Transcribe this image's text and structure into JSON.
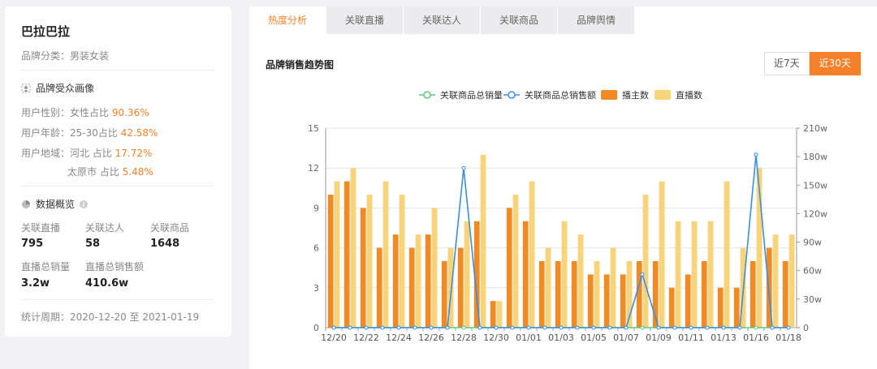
{
  "brand": {
    "name": "巴拉巴拉",
    "category": "品牌分类：男装女装"
  },
  "audience": {
    "title": "品牌受众画像",
    "gender_label": "用户性别：",
    "gender_text": "女性占比 ",
    "gender_value": "90.36%",
    "age_label": "用户年龄：",
    "age_text": "25-30占比 ",
    "age_value": "42.58%",
    "region_label": "用户地域：",
    "region1_text": "河北 占比 ",
    "region1_value": "17.72%",
    "region2_text": "太原市 占比 ",
    "region2_value": "5.48%"
  },
  "overview": {
    "title": "数据概览",
    "stats": [
      {
        "label": "关联直播",
        "value": "795"
      },
      {
        "label": "关联达人",
        "value": "58"
      },
      {
        "label": "关联商品",
        "value": "1648"
      },
      {
        "label": "直播总销量",
        "value": "3.2w"
      },
      {
        "label": "直播总销售额",
        "value": "410.6w"
      }
    ],
    "period": "统计周期：2020-12-20 至 2021-01-19"
  },
  "tabs": [
    "热度分析",
    "关联直播",
    "关联达人",
    "关联商品",
    "品牌舆情"
  ],
  "chart_title": "品牌销售趋势图",
  "range_buttons": [
    "近7天",
    "近30天"
  ],
  "colors": {
    "accent": "#f5822a",
    "bar1": "#f08a24",
    "bar2": "#f7d37a",
    "line_sales_qty": "#5ec77b",
    "line_sales_amt": "#3a8ee6"
  },
  "chart_data": {
    "type": "bar",
    "categories": [
      "12/20",
      "12/21",
      "12/22",
      "12/23",
      "12/24",
      "12/25",
      "12/26",
      "12/27",
      "12/28",
      "12/29",
      "12/30",
      "12/31",
      "01/01",
      "01/02",
      "01/03",
      "01/04",
      "01/05",
      "01/06",
      "01/07",
      "01/08",
      "01/09",
      "01/10",
      "01/11",
      "01/12",
      "01/13",
      "01/14",
      "01/16",
      "01/17",
      "01/18"
    ],
    "x_tick_labels": [
      "12/20",
      "12/22",
      "12/24",
      "12/26",
      "12/28",
      "12/30",
      "01/01",
      "01/03",
      "01/05",
      "01/07",
      "01/09",
      "01/11",
      "01/13",
      "01/16",
      "01/18"
    ],
    "series": [
      {
        "name": "关联商品总销量",
        "type": "line",
        "axis": "left",
        "values": [
          0,
          0,
          0,
          0,
          0,
          0,
          0,
          0,
          0,
          0,
          0,
          0,
          0,
          0,
          0,
          0,
          0,
          0,
          0,
          0,
          0,
          0,
          0,
          0,
          0,
          0,
          0,
          0,
          0
        ]
      },
      {
        "name": "关联商品总销售额",
        "type": "line",
        "axis": "right",
        "values": [
          0,
          0,
          0,
          0,
          0,
          0,
          0,
          0,
          168,
          0,
          0,
          0,
          0,
          0,
          0,
          0,
          0,
          0,
          0,
          56,
          0,
          0,
          0,
          0,
          0,
          0,
          182,
          0,
          0
        ]
      },
      {
        "name": "播主数",
        "type": "bar",
        "axis": "left",
        "values": [
          10,
          11,
          9,
          6,
          7,
          6,
          7,
          5,
          6,
          8,
          2,
          9,
          8,
          5,
          5,
          5,
          4,
          4,
          4,
          5,
          5,
          3,
          4,
          5,
          3,
          3,
          5,
          6,
          5
        ]
      },
      {
        "name": "直播数",
        "type": "bar",
        "axis": "left",
        "values": [
          11,
          12,
          10,
          11,
          10,
          7,
          9,
          6,
          8,
          13,
          2,
          10,
          11,
          6,
          8,
          7,
          5,
          6,
          5,
          10,
          11,
          8,
          8,
          8,
          11,
          6,
          12,
          7,
          7
        ]
      }
    ],
    "y_left": {
      "ticks": [
        0,
        3,
        6,
        9,
        12,
        15
      ],
      "range": [
        0,
        15
      ]
    },
    "y_right": {
      "ticks": [
        "0",
        "30w",
        "60w",
        "90w",
        "120w",
        "150w",
        "180w",
        "210w"
      ],
      "range": [
        0,
        210
      ]
    },
    "grid": true,
    "legend": "top-center"
  }
}
